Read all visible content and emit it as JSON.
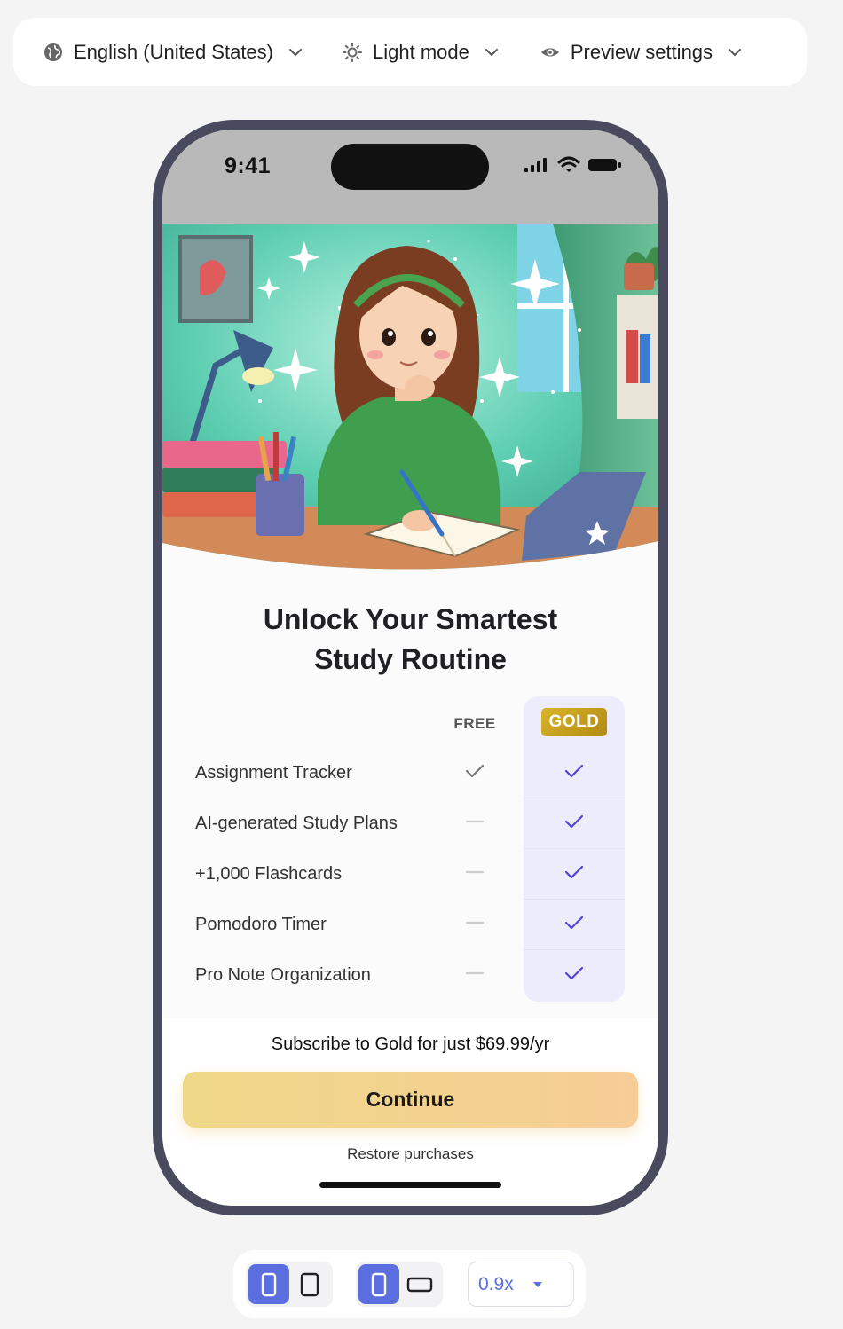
{
  "toolbar": {
    "language": "English (United States)",
    "theme": "Light mode",
    "preview": "Preview settings"
  },
  "phone": {
    "time": "9:41"
  },
  "paywall": {
    "headline_line1": "Unlock Your Smartest",
    "headline_line2": "Study Routine",
    "col_free": "FREE",
    "col_gold": "GOLD",
    "features": [
      {
        "label": "Assignment Tracker",
        "free": true,
        "gold": true
      },
      {
        "label": "AI-generated Study Plans",
        "free": false,
        "gold": true
      },
      {
        "label": "+1,000 Flashcards",
        "free": false,
        "gold": true
      },
      {
        "label": "Pomodoro Timer",
        "free": false,
        "gold": true
      },
      {
        "label": "Pro Note Organization",
        "free": false,
        "gold": true
      }
    ],
    "subscribe_text": "Subscribe to Gold for just $69.99/yr",
    "cta_label": "Continue",
    "restore_label": "Restore purchases"
  },
  "controls": {
    "zoom": "0.9x"
  },
  "colors": {
    "accent": "#5b6ee0",
    "gold_badge": "#c9a11e",
    "cta_start": "#efd888",
    "cta_end": "#f6cd96",
    "phone_frame": "#4a4a5e"
  },
  "icons": {
    "language": "globe-icon",
    "theme": "sun-icon",
    "preview": "eye-icon"
  }
}
